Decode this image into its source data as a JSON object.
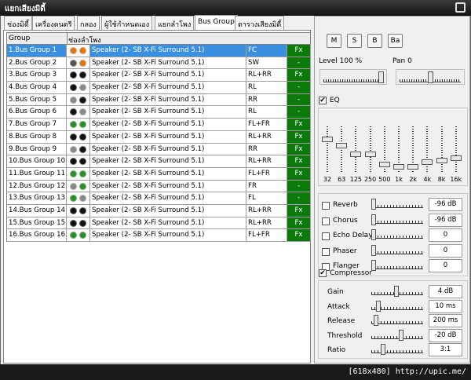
{
  "window": {
    "title": "แยกเสียงมิดี้"
  },
  "tabs": [
    "ช่องมิดี้",
    "เครื่องดนตรี",
    "กลอง",
    "ผู้ใช้กำหนดเอง",
    "แยกลำโพง",
    "Bus Group",
    "ตารางเสียงมิดี้"
  ],
  "table": {
    "headers": {
      "group": "Group",
      "speaker": "ช่องลำโพง"
    },
    "rows": [
      {
        "name": "1.Bus Group 1",
        "speaker": "Speaker (2- SB X-Fi Surround 5.1)",
        "channel": "FC",
        "fx": "Fx",
        "dots": [
          "#d9761c",
          "#d9761c"
        ]
      },
      {
        "name": "2.Bus Group 2",
        "speaker": "Speaker (2- SB X-Fi Surround 5.1)",
        "channel": "SW",
        "fx": "-",
        "dots": [
          "#555555",
          "#d9761c"
        ]
      },
      {
        "name": "3.Bus Group 3",
        "speaker": "Speaker (2- SB X-Fi Surround 5.1)",
        "channel": "RL+RR",
        "fx": "Fx",
        "dots": [
          "#111111",
          "#111111"
        ]
      },
      {
        "name": "4.Bus Group 4",
        "speaker": "Speaker (2- SB X-Fi Surround 5.1)",
        "channel": "RL",
        "fx": "-",
        "dots": [
          "#111111",
          "#888888"
        ]
      },
      {
        "name": "5.Bus Group 5",
        "speaker": "Speaker (2- SB X-Fi Surround 5.1)",
        "channel": "RR",
        "fx": "-",
        "dots": [
          "#888888",
          "#111111"
        ]
      },
      {
        "name": "6.Bus Group 6",
        "speaker": "Speaker (2- SB X-Fi Surround 5.1)",
        "channel": "RL",
        "fx": "-",
        "dots": [
          "#111111",
          "#888888"
        ]
      },
      {
        "name": "7.Bus Group 7",
        "speaker": "Speaker (2- SB X-Fi Surround 5.1)",
        "channel": "FL+FR",
        "fx": "Fx",
        "dots": [
          "#2f8a2f",
          "#2f8a2f"
        ]
      },
      {
        "name": "8.Bus Group 8",
        "speaker": "Speaker (2- SB X-Fi Surround 5.1)",
        "channel": "RL+RR",
        "fx": "Fx",
        "dots": [
          "#111111",
          "#111111"
        ]
      },
      {
        "name": "9.Bus Group 9",
        "speaker": "Speaker (2- SB X-Fi Surround 5.1)",
        "channel": "RR",
        "fx": "Fx",
        "dots": [
          "#888888",
          "#111111"
        ]
      },
      {
        "name": "10.Bus Group 10",
        "speaker": "Speaker (2- SB X-Fi Surround 5.1)",
        "channel": "RL+RR",
        "fx": "Fx",
        "dots": [
          "#111111",
          "#111111"
        ]
      },
      {
        "name": "11.Bus Group 11",
        "speaker": "Speaker (2- SB X-Fi Surround 5.1)",
        "channel": "FL+FR",
        "fx": "Fx",
        "dots": [
          "#2f8a2f",
          "#2f8a2f"
        ]
      },
      {
        "name": "12.Bus Group 12",
        "speaker": "Speaker (2- SB X-Fi Surround 5.1)",
        "channel": "FR",
        "fx": "-",
        "dots": [
          "#888888",
          "#2f8a2f"
        ]
      },
      {
        "name": "13.Bus Group 13",
        "speaker": "Speaker (2- SB X-Fi Surround 5.1)",
        "channel": "FL",
        "fx": "-",
        "dots": [
          "#2f8a2f",
          "#888888"
        ]
      },
      {
        "name": "14.Bus Group 14",
        "speaker": "Speaker (2- SB X-Fi Surround 5.1)",
        "channel": "RL+RR",
        "fx": "Fx",
        "dots": [
          "#111111",
          "#111111"
        ]
      },
      {
        "name": "15.Bus Group 15",
        "speaker": "Speaker (2- SB X-Fi Surround 5.1)",
        "channel": "RL+RR",
        "fx": "Fx",
        "dots": [
          "#111111",
          "#111111"
        ]
      },
      {
        "name": "16.Bus Group 16",
        "speaker": "Speaker (2- SB X-Fi Surround 5.1)",
        "channel": "FL+FR",
        "fx": "Fx",
        "dots": [
          "#2f8a2f",
          "#2f8a2f"
        ]
      }
    ]
  },
  "right": {
    "buttons": [
      "M",
      "S",
      "B",
      "Ba"
    ],
    "level_label": "Level 100 %",
    "pan_label": "Pan 0",
    "level_value": 1.0,
    "pan_value": 0.5,
    "eq": {
      "label": "EQ",
      "checked": true,
      "bands": [
        "32",
        "63",
        "125",
        "250",
        "500",
        "1k",
        "2k",
        "4k",
        "8k",
        "16k"
      ],
      "levels": [
        0.25,
        0.4,
        0.6,
        0.6,
        0.85,
        0.9,
        0.9,
        0.8,
        0.75,
        0.7
      ]
    },
    "effects": [
      {
        "name": "Reverb",
        "value": "-96 dB",
        "level": 0.0,
        "checked": false
      },
      {
        "name": "Chorus",
        "value": "-96 dB",
        "level": 0.0,
        "checked": false
      },
      {
        "name": "Echo Delay",
        "value": "0",
        "level": 0.0,
        "checked": false
      },
      {
        "name": "Phaser",
        "value": "0",
        "level": 0.0,
        "checked": false
      },
      {
        "name": "Flanger",
        "value": "0",
        "level": 0.0,
        "checked": false
      }
    ],
    "compressor": {
      "label": "Compressor",
      "checked": true,
      "params": [
        {
          "name": "Gain",
          "value": "4 dB",
          "level": 0.5
        },
        {
          "name": "Attack",
          "value": "10 ms",
          "level": 0.1
        },
        {
          "name": "Release",
          "value": "200 ms",
          "level": 0.05
        },
        {
          "name": "Threshold",
          "value": "-20 dB",
          "level": 0.6
        },
        {
          "name": "Ratio",
          "value": "3:1",
          "level": 0.2
        }
      ]
    }
  },
  "watermark": "[618x480] http://upic.me/",
  "colors": {
    "fx_green": "#0b7a0b",
    "selection": "#3a8fe0"
  }
}
